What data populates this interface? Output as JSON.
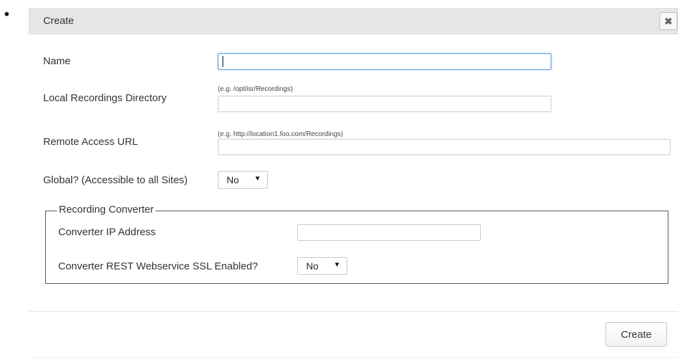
{
  "dialog": {
    "title": "Create",
    "close_icon": "times-icon",
    "close_glyph": "✖"
  },
  "form": {
    "name": {
      "label": "Name",
      "value": ""
    },
    "local_dir": {
      "label": "Local Recordings Directory",
      "hint": "(e.g. /opt/isr/Recordings)",
      "value": ""
    },
    "remote_url": {
      "label": "Remote Access URL",
      "hint": "(e.g. http://location1.foo.com/Recordings)",
      "value": ""
    },
    "global": {
      "label": "Global? (Accessible to all Sites)",
      "value": "No",
      "arrow": "▼"
    }
  },
  "converter": {
    "legend": "Recording Converter",
    "ip": {
      "label": "Converter IP Address",
      "value": ""
    },
    "ssl": {
      "label": "Converter REST Webservice SSL Enabled?",
      "value": "No",
      "arrow": "▼"
    }
  },
  "footer": {
    "create_label": "Create"
  },
  "page": {
    "bullet": "•"
  },
  "colors": {
    "header_bg": "#e6e6e6",
    "focus_border": "#5b9dd9",
    "fieldset_border": "#555555"
  }
}
